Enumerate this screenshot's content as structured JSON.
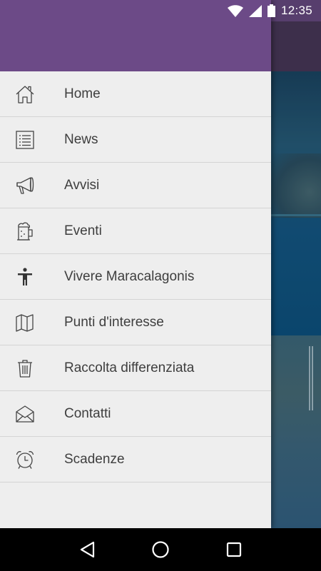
{
  "status_bar": {
    "time": "12:35",
    "icons": [
      "wifi-icon",
      "signal-icon",
      "battery-icon"
    ]
  },
  "drawer": {
    "header_color": "#6c4a87",
    "items": [
      {
        "label": "Home",
        "icon": "home-icon"
      },
      {
        "label": "News",
        "icon": "list-icon"
      },
      {
        "label": "Avvisi",
        "icon": "megaphone-icon"
      },
      {
        "label": "Eventi",
        "icon": "beer-mug-icon"
      },
      {
        "label": "Vivere Maracalagonis",
        "icon": "person-icon"
      },
      {
        "label": "Punti d'interesse",
        "icon": "map-icon"
      },
      {
        "label": "Raccolta differenziata",
        "icon": "trash-icon"
      },
      {
        "label": "Contatti",
        "icon": "envelope-icon"
      },
      {
        "label": "Scadenze",
        "icon": "alarm-clock-icon"
      }
    ]
  },
  "nav_bar": {
    "buttons": [
      "back-icon",
      "home-circle-icon",
      "recents-icon"
    ]
  },
  "colors": {
    "primary": "#6c4a87",
    "drawer_bg": "#eeeeee",
    "text": "#3e3e3e"
  }
}
